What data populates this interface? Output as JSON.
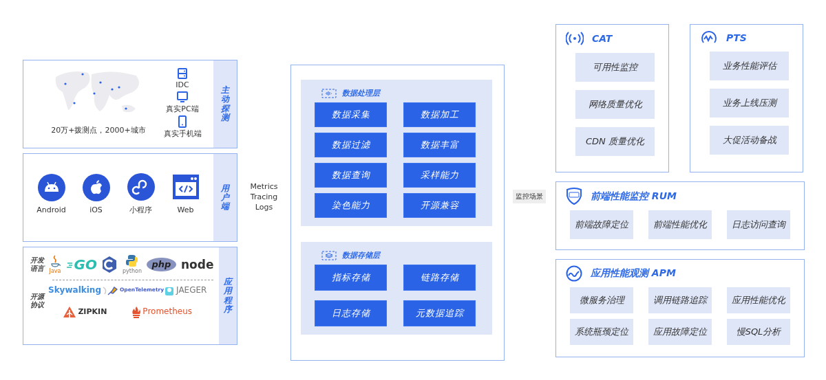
{
  "probe": {
    "side_label": "主动探测",
    "map_caption": "20万+拨测点，2000+城市",
    "endpoints": [
      {
        "kind": "server",
        "label": "IDC"
      },
      {
        "kind": "monitor",
        "label": "真实PC端"
      },
      {
        "kind": "phone",
        "label": "真实手机端"
      }
    ]
  },
  "client": {
    "side_label": "用户端",
    "platforms": [
      {
        "kind": "android",
        "label": "Android"
      },
      {
        "kind": "apple",
        "label": "iOS"
      },
      {
        "kind": "miniapp",
        "label": "小程序"
      },
      {
        "kind": "web",
        "label": "Web"
      }
    ]
  },
  "app": {
    "side_label": "应用程序",
    "languages_label": "开发语言",
    "languages": [
      {
        "kind": "java",
        "label": "Java"
      },
      {
        "kind": "go",
        "label": "GO"
      },
      {
        "kind": "cpp"
      },
      {
        "kind": "python",
        "label": "python"
      },
      {
        "kind": "php",
        "label": "php"
      },
      {
        "kind": "node",
        "label": "node"
      }
    ],
    "protocols_label": "开源协议",
    "protocols": [
      {
        "kind": "skywalking",
        "label": "Skywalking"
      },
      {
        "kind": "opentelemetry",
        "label": "OpenTelemetry"
      },
      {
        "kind": "jaeger",
        "label": "JAEGER"
      },
      {
        "kind": "zipkin",
        "label": "ZIPKIN"
      },
      {
        "kind": "prometheus",
        "label": "Prometheus"
      }
    ]
  },
  "signals": [
    "Metrics",
    "Tracing",
    "Logs"
  ],
  "processing": {
    "title": "数据处理层",
    "items": [
      "数据采集",
      "数据加工",
      "数据过滤",
      "数据丰富",
      "数据查询",
      "采样能力",
      "染色能力",
      "开源兼容"
    ]
  },
  "storage": {
    "title": "数据存储层",
    "items": [
      "指标存储",
      "链路存储",
      "日志存储",
      "元数据追踪"
    ]
  },
  "scenario_label": "监控场景",
  "products": [
    {
      "kind": "cat",
      "title": "CAT",
      "items": [
        "可用性监控",
        "网络质量优化",
        "CDN 质量优化"
      ]
    },
    {
      "kind": "pts",
      "title": "PTS",
      "items": [
        "业务性能评估",
        "业务上线压测",
        "大促活动备战"
      ]
    },
    {
      "kind": "rum",
      "title": "前端性能监控 RUM",
      "items": [
        "前端故障定位",
        "前端性能优化",
        "日志访问查询"
      ]
    },
    {
      "kind": "apm",
      "title": "应用性能观测 APM",
      "items": [
        "微服务治理",
        "调用链路追踪",
        "应用性能优化",
        "系统瓶颈定位",
        "应用故障定位",
        "慢SQL分析"
      ]
    }
  ]
}
